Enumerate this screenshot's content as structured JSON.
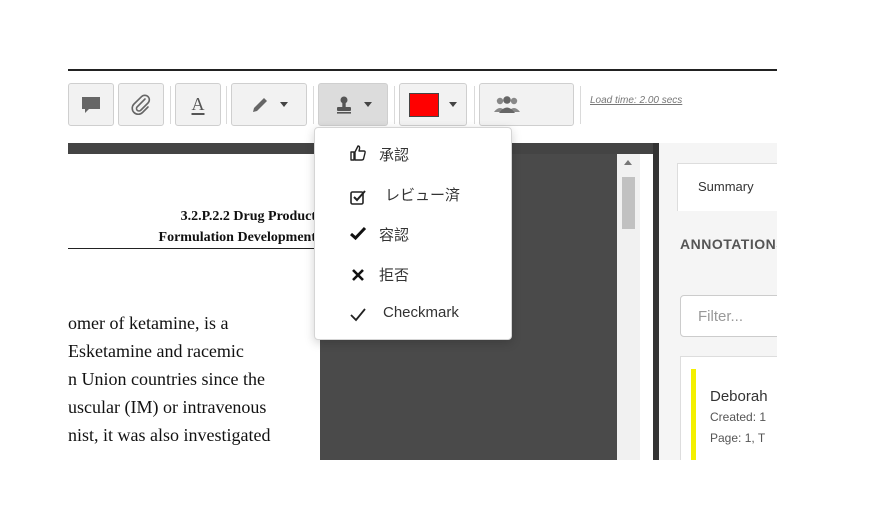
{
  "toolbar": {
    "buttons": [
      {
        "name": "comment-icon"
      },
      {
        "name": "paperclip-icon"
      },
      {
        "name": "text-icon",
        "label": "A"
      },
      {
        "name": "pen-icon"
      },
      {
        "name": "stamp-icon"
      },
      {
        "name": "color-picker",
        "color": "#ff0000"
      },
      {
        "name": "users-icon"
      }
    ],
    "load_time": "Load time: 2.00 secs"
  },
  "stamp_menu": {
    "items": [
      {
        "icon": "thumbs-up-icon",
        "label": "承認"
      },
      {
        "icon": "checked-box-icon",
        "label": "レビュー済"
      },
      {
        "icon": "bold-check-icon",
        "label": "容認"
      },
      {
        "icon": "cross-icon",
        "label": "拒否"
      },
      {
        "icon": "checkmark-icon",
        "label": "Checkmark"
      }
    ]
  },
  "document": {
    "heading_line1": "3.2.P.2.2 Drug Product",
    "heading_line2": "Formulation Development",
    "body_lines": [
      "omer  of  ketamine,  is  a",
      "Esketamine  and  racemic",
      "n Union countries since the",
      "uscular (IM) or intravenous",
      "nist, it was also investigated"
    ]
  },
  "right_panel": {
    "tab_label": "Summary",
    "annotations_title": "ANNOTATIONS",
    "filter_placeholder": "Filter...",
    "card": {
      "author": "Deborah",
      "created": "Created: 1",
      "page": "Page: 1, T",
      "accent_color": "#f4f000"
    }
  }
}
